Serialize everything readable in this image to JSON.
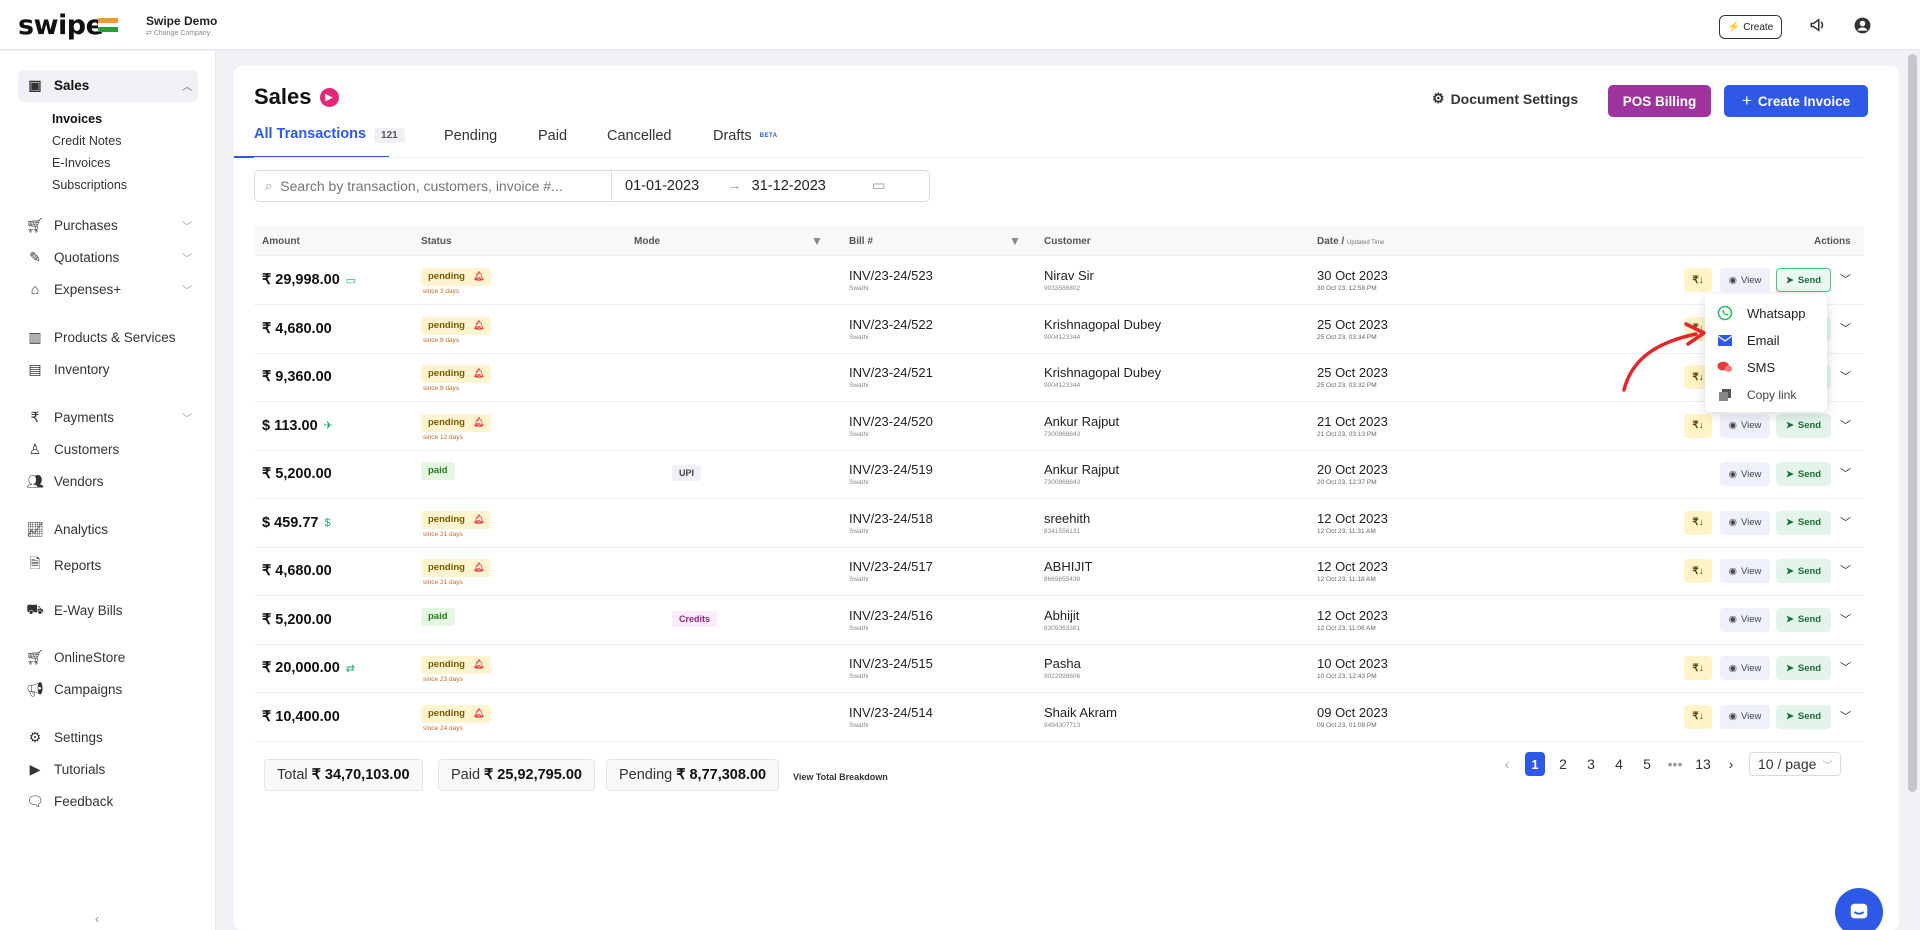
{
  "topbar": {
    "logo": "swipe",
    "company_name": "Swipe Demo",
    "change_company": "Change Company",
    "create_label": "Create"
  },
  "sidebar": {
    "sales": "Sales",
    "sub": [
      "Invoices",
      "Credit Notes",
      "E-Invoices",
      "Subscriptions"
    ],
    "items": [
      {
        "label": "Purchases"
      },
      {
        "label": "Quotations"
      },
      {
        "label": "Expenses+"
      },
      {
        "label": "Products & Services"
      },
      {
        "label": "Inventory"
      },
      {
        "label": "Payments"
      },
      {
        "label": "Customers"
      },
      {
        "label": "Vendors"
      },
      {
        "label": "Analytics"
      },
      {
        "label": "Reports"
      },
      {
        "label": "E-Way Bills"
      },
      {
        "label": "OnlineStore"
      },
      {
        "label": "Campaigns"
      },
      {
        "label": "Settings"
      },
      {
        "label": "Tutorials"
      },
      {
        "label": "Feedback"
      }
    ]
  },
  "header": {
    "title": "Sales",
    "doc_settings": "Document Settings",
    "pos_billing": "POS Billing",
    "create_invoice": "Create Invoice"
  },
  "tabs": {
    "all": "All Transactions",
    "all_count": "121",
    "pending": "Pending",
    "paid": "Paid",
    "cancelled": "Cancelled",
    "drafts": "Drafts",
    "beta": "BETA"
  },
  "filters": {
    "search_placeholder": "Search by transaction, customers, invoice #...",
    "date_from": "01-01-2023",
    "date_to": "31-12-2023"
  },
  "table": {
    "headers": {
      "amount": "Amount",
      "status": "Status",
      "mode": "Mode",
      "bill": "Bill #",
      "customer": "Customer",
      "date": "Date /",
      "date_sub": "Updated Time",
      "actions": "Actions"
    },
    "rows": [
      {
        "amount": "₹ 29,998.00",
        "status": "pending",
        "since": "since 3 days",
        "mode": "",
        "bill": "INV/23-24/523",
        "bill_sub": "Swathi",
        "customer": "Nirav Sir",
        "phone": "9033586802",
        "date": "30 Oct 2023",
        "time": "30 Oct 23, 12:58 PM"
      },
      {
        "amount": "₹ 4,680.00",
        "status": "pending",
        "since": "since 8 days",
        "mode": "",
        "bill": "INV/23-24/522",
        "bill_sub": "Swathi",
        "customer": "Krishnagopal Dubey",
        "phone": "9004123344",
        "date": "25 Oct 2023",
        "time": "25 Oct 23, 03:34 PM"
      },
      {
        "amount": "₹ 9,360.00",
        "status": "pending",
        "since": "since 8 days",
        "mode": "",
        "bill": "INV/23-24/521",
        "bill_sub": "Swathi",
        "customer": "Krishnagopal Dubey",
        "phone": "9004123344",
        "date": "25 Oct 2023",
        "time": "25 Oct 23, 03:32 PM"
      },
      {
        "amount": "$ 113.00",
        "status": "pending",
        "since": "since 12 days",
        "mode": "",
        "bill": "INV/23-24/520",
        "bill_sub": "Swathi",
        "customer": "Ankur Rajput",
        "phone": "7300868843",
        "date": "21 Oct 2023",
        "time": "21 Oct 23, 03:13 PM"
      },
      {
        "amount": "₹ 5,200.00",
        "status": "paid",
        "since": "",
        "mode": "UPI",
        "bill": "INV/23-24/519",
        "bill_sub": "Swathi",
        "customer": "Ankur Rajput",
        "phone": "7300868843",
        "date": "20 Oct 2023",
        "time": "20 Oct 23, 12:37 PM"
      },
      {
        "amount": "$ 459.77",
        "status": "pending",
        "since": "since 21 days",
        "mode": "",
        "bill": "INV/23-24/518",
        "bill_sub": "Swathi",
        "customer": "sreehith",
        "phone": "8341556131",
        "date": "12 Oct 2023",
        "time": "12 Oct 23, 11:31 AM"
      },
      {
        "amount": "₹ 4,680.00",
        "status": "pending",
        "since": "since 21 days",
        "mode": "",
        "bill": "INV/23-24/517",
        "bill_sub": "Swathi",
        "customer": "ABHIJIT",
        "phone": "8669655438",
        "date": "12 Oct 2023",
        "time": "12 Oct 23, 11:18 AM"
      },
      {
        "amount": "₹ 5,200.00",
        "status": "paid",
        "since": "",
        "mode": "Credits",
        "bill": "INV/23-24/516",
        "bill_sub": "Swathi",
        "customer": "Abhijit",
        "phone": "8309363381",
        "date": "12 Oct 2023",
        "time": "12 Oct 23, 11:06 AM"
      },
      {
        "amount": "₹ 20,000.00",
        "status": "pending",
        "since": "since 23 days",
        "mode": "",
        "bill": "INV/23-24/515",
        "bill_sub": "Swathi",
        "customer": "Pasha",
        "phone": "9022098606",
        "date": "10 Oct 2023",
        "time": "10 Oct 23, 12:43 PM"
      },
      {
        "amount": "₹ 10,400.00",
        "status": "pending",
        "since": "since 24 days",
        "mode": "",
        "bill": "INV/23-24/514",
        "bill_sub": "Swathi",
        "customer": "Shaik Akram",
        "phone": "9494307713",
        "date": "09 Oct 2023",
        "time": "09 Oct 23, 01:08 PM"
      }
    ],
    "action_pay": "₹↓",
    "action_view": "View",
    "action_send": "Send"
  },
  "totals": {
    "total_label": "Total",
    "total": "₹ 34,70,103.00",
    "paid_label": "Paid",
    "paid": "₹ 25,92,795.00",
    "pending_label": "Pending",
    "pending": "₹ 8,77,308.00",
    "breakdown": "View Total Breakdown"
  },
  "pagination": {
    "pages": [
      "1",
      "2",
      "3",
      "4",
      "5"
    ],
    "ellipsis": "•••",
    "last": "13",
    "per_page": "10 / page"
  },
  "send_menu": {
    "whatsapp": "Whatsapp",
    "email": "Email",
    "sms": "SMS",
    "copy": "Copy link"
  }
}
